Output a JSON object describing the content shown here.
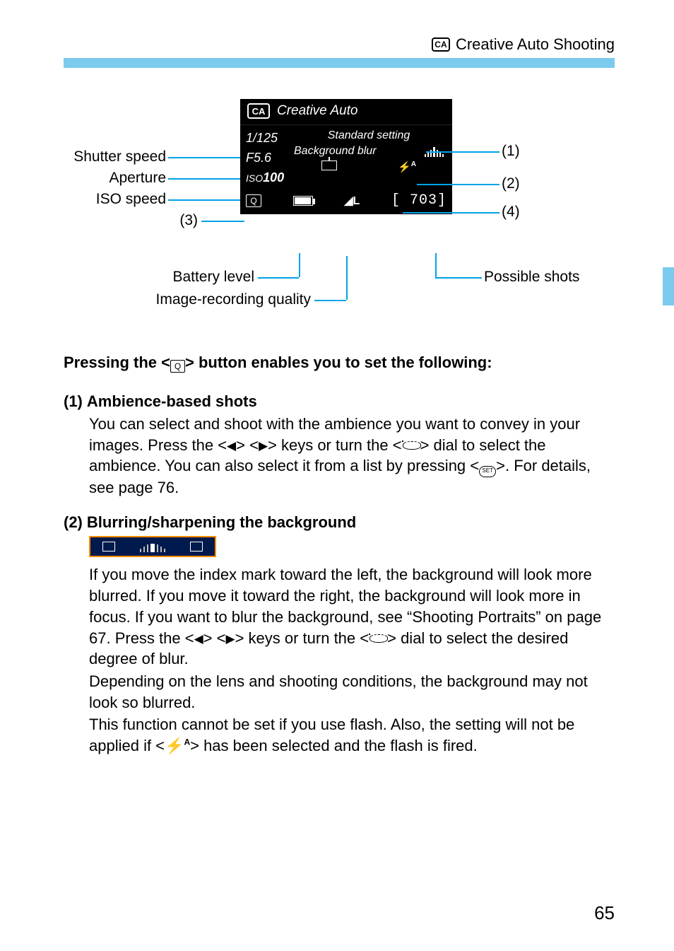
{
  "header": {
    "title": "Creative Auto Shooting"
  },
  "diagram": {
    "left_labels": {
      "shutter": "Shutter speed",
      "aperture": "Aperture",
      "iso": "ISO speed",
      "n3": "(3)"
    },
    "right_labels": {
      "n1": "(1)",
      "n2": "(2)",
      "n4": "(4)",
      "possible": "Possible shots"
    },
    "bottom_labels": {
      "battery": "Battery level",
      "quality": "Image-recording quality"
    },
    "screen": {
      "mode_icon": "CA",
      "mode_title": "Creative Auto",
      "shutter": "1/125",
      "aperture": "F5.6",
      "iso_label": "ISO",
      "iso_value": "100",
      "ambience": "Standard setting",
      "blur_label": "Background blur",
      "flash_setting": "A",
      "quality_icon": "◢L",
      "remaining": "[  703]"
    }
  },
  "intro_line": {
    "pre": "Pressing the <",
    "q": "Q",
    "post": "> button enables you to set the following:"
  },
  "section1": {
    "num": "(1)",
    "title": "Ambience-based shots",
    "p_a": "You can select and shoot with the ambience you want to convey in your images. Press the <",
    "p_b": "> <",
    "p_c": "> keys or turn the <",
    "p_d": "> dial to select the ambience. You can also select it from a list by pressing <",
    "set": "SET",
    "p_e": ">. For details, see page 76."
  },
  "section2": {
    "num": "(2)",
    "title": "Blurring/sharpening the background",
    "p1_a": "If you move the index mark toward the left, the background will look more blurred. If you move it toward the right, the background will look more in focus. If you want to blur the background, see “Shooting Portraits” on page 67. Press the <",
    "p1_b": "> <",
    "p1_c": "> keys or turn the <",
    "p1_d": "> dial to select the desired degree of blur.",
    "p2": "Depending on the lens and shooting conditions, the background may not look so blurred.",
    "p3_a": "This function cannot be set if you use flash. Also, the setting will not be applied if <",
    "p3_b": "> has been selected and the flash is fired."
  },
  "page_number": "65"
}
